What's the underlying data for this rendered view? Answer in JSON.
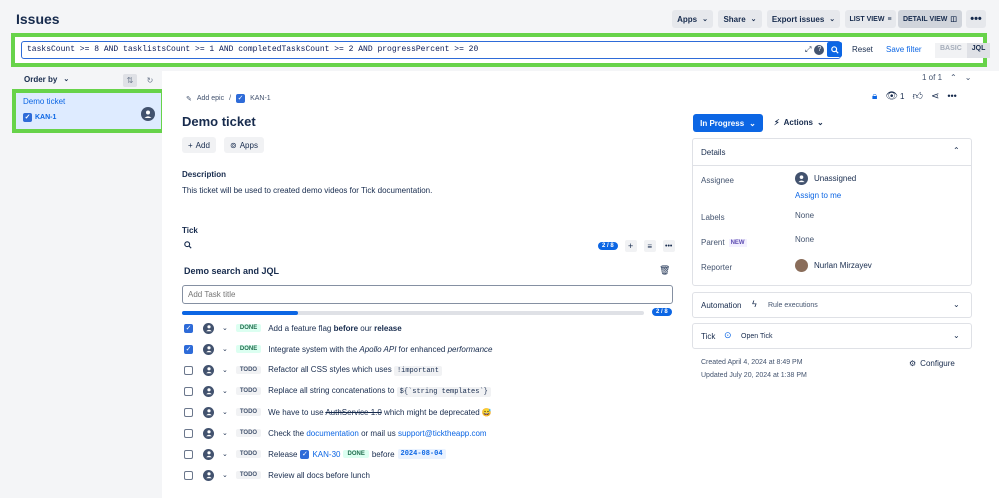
{
  "header": {
    "title": "Issues",
    "buttons": [
      "Apps",
      "Share",
      "Export issues"
    ],
    "list_view": "LIST VIEW",
    "detail_view": "DETAIL VIEW"
  },
  "jql": {
    "query": "tasksCount >= 8 AND tasklistsCount >= 1 AND completedTasksCount >= 2 AND progressPercent >= 20",
    "reset": "Reset",
    "save_filter": "Save filter",
    "basic": "BASIC",
    "jql": "JQL"
  },
  "sidebar": {
    "order_by": "Order by",
    "ticket_name": "Demo ticket",
    "ticket_key": "KAN-1"
  },
  "issue": {
    "pager": "1 of 1",
    "add_epic": "Add epic",
    "crumb_sep": "/",
    "key": "KAN-1",
    "watchers": "1",
    "title": "Demo ticket",
    "add": "Add",
    "apps": "Apps",
    "description_label": "Description",
    "description": "This ticket will be used to created demo videos for Tick documentation.",
    "tick_label": "Tick",
    "progress_badge": "2 / 8",
    "progress_fraction": 0.25,
    "list_title": "Demo search and JQL",
    "add_task_placeholder": "Add Task title",
    "progress_text": "2 / 8",
    "tasks": [
      {
        "checked": true,
        "status": "DONE",
        "parts": [
          "Add a feature flag ",
          "before",
          " our ",
          "release"
        ]
      },
      {
        "checked": true,
        "status": "DONE",
        "parts": [
          "Integrate system with the ",
          "Apollo API",
          " for enhanced ",
          "performance"
        ]
      },
      {
        "checked": false,
        "status": "TODO",
        "parts": [
          "Refactor all CSS styles which uses ",
          "!important"
        ]
      },
      {
        "checked": false,
        "status": "TODO",
        "parts": [
          "Replace all string concatenations to ",
          "${`string templates`}"
        ]
      },
      {
        "checked": false,
        "status": "TODO",
        "parts": [
          "We have to use ",
          "AuthService 1.0",
          " which might be deprecated ",
          "😅"
        ]
      },
      {
        "checked": false,
        "status": "TODO",
        "parts": [
          "Check the ",
          "documentation",
          " or mail us ",
          "support@ticktheapp.com"
        ]
      },
      {
        "checked": false,
        "status": "TODO",
        "parts": [
          "Release ",
          "KAN-30",
          "DONE",
          " before ",
          "2024-08-04"
        ]
      },
      {
        "checked": false,
        "status": "TODO",
        "parts": [
          "Review all docs before lunch"
        ]
      }
    ]
  },
  "side": {
    "status": "In Progress",
    "actions": "Actions",
    "details": "Details",
    "assignee_label": "Assignee",
    "assignee": "Unassigned",
    "assign_to_me": "Assign to me",
    "labels_label": "Labels",
    "labels": "None",
    "parent_label": "Parent",
    "parent_badge": "NEW",
    "parent": "None",
    "reporter_label": "Reporter",
    "reporter": "Nurlan Mirzayev",
    "automation": "Automation",
    "rule_executions": "Rule executions",
    "tick": "Tick",
    "open_tick": "Open Tick",
    "created": "Created April 4, 2024 at 8:49 PM",
    "updated": "Updated July 20, 2024 at 1:38 PM",
    "configure": "Configure"
  },
  "colors": {
    "highlight": "#67d34a",
    "primary": "#0c66e4",
    "status": "#0c66e4"
  }
}
